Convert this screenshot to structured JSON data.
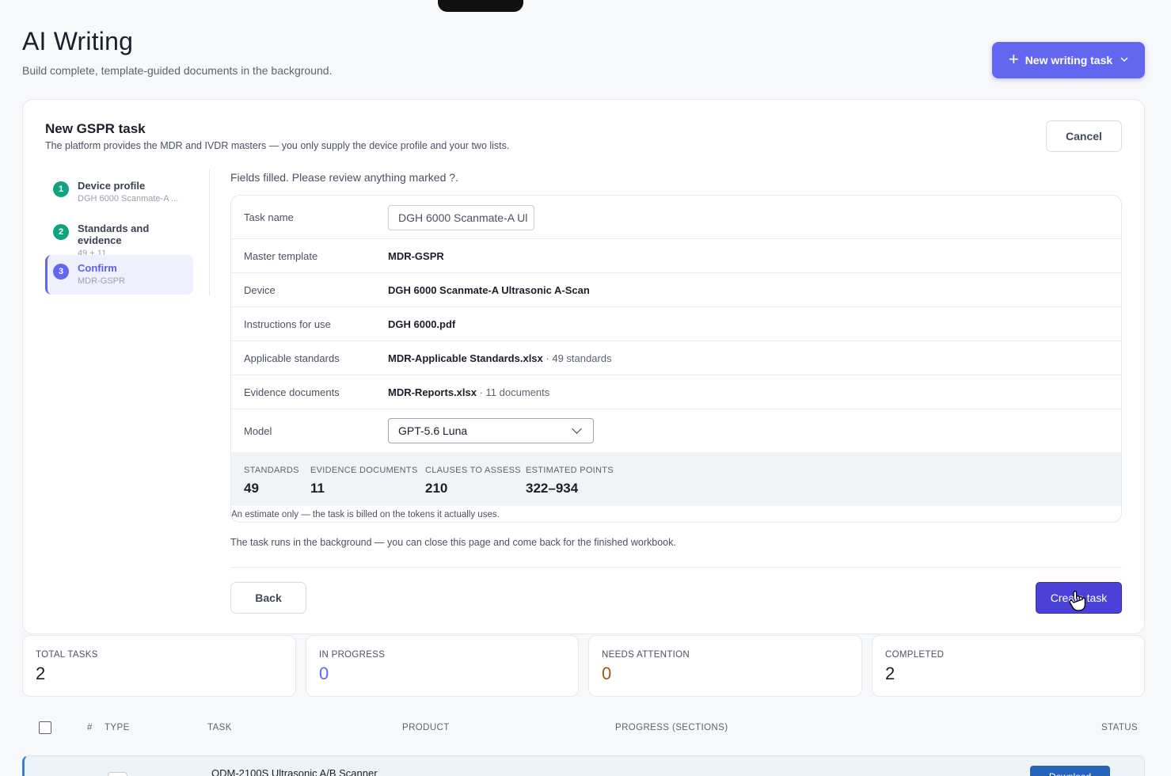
{
  "header": {
    "title": "AI Writing",
    "subtitle": "Build complete, template-guided documents in the background.",
    "new_task_label": "New writing task"
  },
  "wizard": {
    "title": "New GSPR task",
    "subtitle": "The platform provides the MDR and IVDR masters — you only supply the device profile and your two lists.",
    "cancel_label": "Cancel",
    "steps": [
      {
        "num": "1",
        "label": "Device profile",
        "sub": "DGH 6000 Scanmate-A ..."
      },
      {
        "num": "2",
        "label": "Standards and evidence",
        "sub": "49 + 11"
      },
      {
        "num": "3",
        "label": "Confirm",
        "sub": "MDR-GSPR"
      }
    ],
    "filled_message": "Fields filled. Please review anything marked ?.",
    "fields": {
      "task_name_label": "Task name",
      "task_name_value": "DGH 6000 Scanmate-A Ul",
      "master_template_label": "Master template",
      "master_template_value": "MDR-GSPR",
      "device_label": "Device",
      "device_value": "DGH 6000 Scanmate-A Ultrasonic A-Scan",
      "ifu_label": "Instructions for use",
      "ifu_value": "DGH 6000.pdf",
      "standards_label": "Applicable standards",
      "standards_file": "MDR-Applicable Standards.xlsx",
      "standards_count": " · 49 standards",
      "evidence_label": "Evidence documents",
      "evidence_file": "MDR-Reports.xlsx",
      "evidence_count": " · 11 documents",
      "model_label": "Model",
      "model_value": "GPT-5.6 Luna"
    },
    "summary": [
      {
        "label": "STANDARDS",
        "value": "49"
      },
      {
        "label": "EVIDENCE DOCUMENTS",
        "value": "11"
      },
      {
        "label": "CLAUSES TO ASSESS",
        "value": "210"
      },
      {
        "label": "ESTIMATED POINTS",
        "value": "322–934"
      }
    ],
    "estimate_note": "An estimate only — the task is billed on the tokens it actually uses.",
    "background_note": "The task runs in the background — you can close this page and come back for the finished workbook.",
    "back_label": "Back",
    "create_label": "Create task"
  },
  "kpis": [
    {
      "label": "TOTAL TASKS",
      "value": "2"
    },
    {
      "label": "IN PROGRESS",
      "value": "0"
    },
    {
      "label": "NEEDS ATTENTION",
      "value": "0"
    },
    {
      "label": "COMPLETED",
      "value": "2"
    }
  ],
  "table": {
    "headers": [
      "#",
      "TYPE",
      "TASK",
      "PRODUCT",
      "PROGRESS (SECTIONS)",
      "STATUS"
    ],
    "rows": [
      {
        "task": "ODM-2100S Ultrasonic A/B Scanner",
        "action": "Download"
      }
    ]
  },
  "colors": {
    "accent": "#6366f1",
    "create_button": "#4a42d8",
    "step_done": "#10a37f",
    "attention": "#9a5a14",
    "download_button": "#2563b8"
  },
  "icons": [
    "plus-icon",
    "chevron-down-icon",
    "cursor-hand-icon"
  ]
}
